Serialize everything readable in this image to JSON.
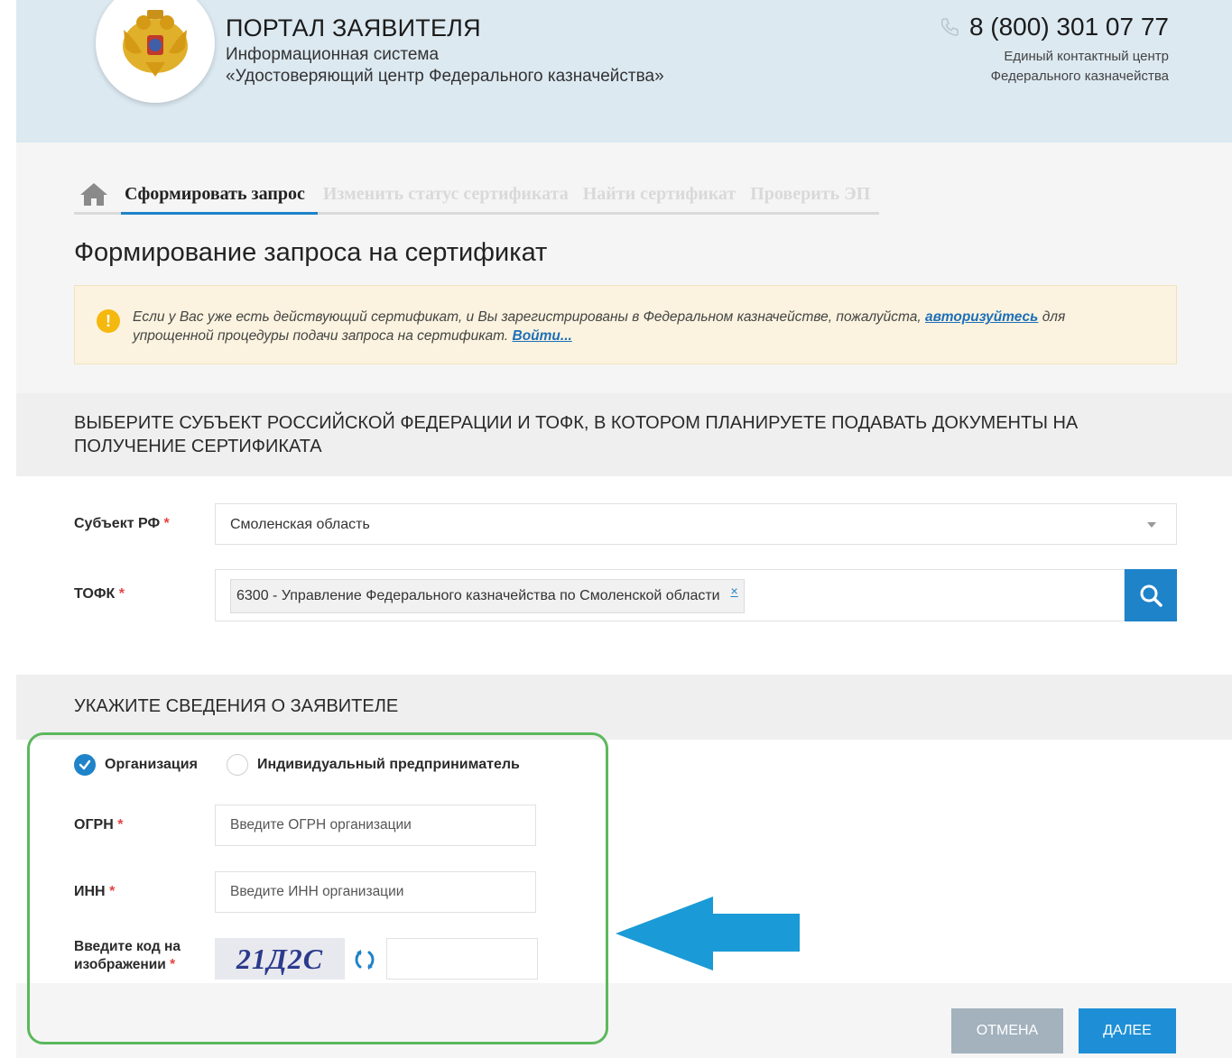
{
  "header": {
    "portal_title": "ПОРТАЛ ЗАЯВИТЕЛЯ",
    "subtitle_line1": "Информационная система",
    "subtitle_line2": "«Удостоверяющий центр Федерального казначейства»",
    "phone": "8 (800) 301 07 77",
    "contact_line1": "Единый контактный центр",
    "contact_line2": "Федерального казначейства"
  },
  "nav": {
    "tabs": [
      {
        "label": "Сформировать запрос",
        "active": true
      },
      {
        "label": "Изменить статус сертификата",
        "active": false
      },
      {
        "label": "Найти сертификат",
        "active": false
      },
      {
        "label": "Проверить ЭП",
        "active": false
      }
    ]
  },
  "main": {
    "heading": "Формирование запроса на сертификат",
    "notice": {
      "icon_text": "!",
      "text_before": "Если у Вас уже есть действующий сертификат, и Вы зарегистрированы в Федеральном казначействе, пожалуйста,",
      "link_authorize": "авторизуйтесь",
      "text_after": "для упрощенной процедуры подачи запроса на сертификат.",
      "link_login": "Войти..."
    }
  },
  "section_region": {
    "title": "ВЫБЕРИТЕ СУБЪЕКТ РОССИЙСКОЙ ФЕДЕРАЦИИ И ТОФК, В КОТОРОМ ПЛАНИРУЕТЕ ПОДАВАТЬ ДОКУМЕНТЫ НА ПОЛУЧЕНИЕ СЕРТИФИКАТА",
    "subject_label": "Субъект РФ",
    "subject_value": "Смоленская область",
    "tofk_label": "ТОФК",
    "tofk_value": "6300 - Управление Федерального казначейства по Смоленской области",
    "tofk_remove": "×",
    "required_mark": "*"
  },
  "section_applicant": {
    "title": "УКАЖИТЕ СВЕДЕНИЯ О ЗАЯВИТЕЛЕ",
    "radio_org": "Организация",
    "radio_ip": "Индивидуальный предприниматель",
    "radio_org_checked": true,
    "ogrn_label": "ОГРН",
    "ogrn_placeholder": "Введите ОГРН организации",
    "inn_label": "ИНН",
    "inn_placeholder": "Введите ИНН организации",
    "captcha_label_line1": "Введите код на",
    "captcha_label_line2": "изображении",
    "captcha_text": "21Д2С"
  },
  "footer": {
    "cancel_label": "ОТМЕНА",
    "next_label": "ДАЛЕЕ"
  },
  "colors": {
    "header_bg": "#dce9f1",
    "accent_blue": "#1e83c9",
    "required_red": "#e54444",
    "highlight_green": "#5cb85c",
    "arrow_blue": "#1a9ad6",
    "cancel_gray": "#a3b2bd"
  },
  "icons": {
    "logo": "double-headed-eagle-emblem",
    "phone": "phone-icon",
    "home": "home-icon",
    "notice": "info-icon",
    "search": "search-icon",
    "refresh": "refresh-icon",
    "arrow": "arrow-left-annotation"
  }
}
